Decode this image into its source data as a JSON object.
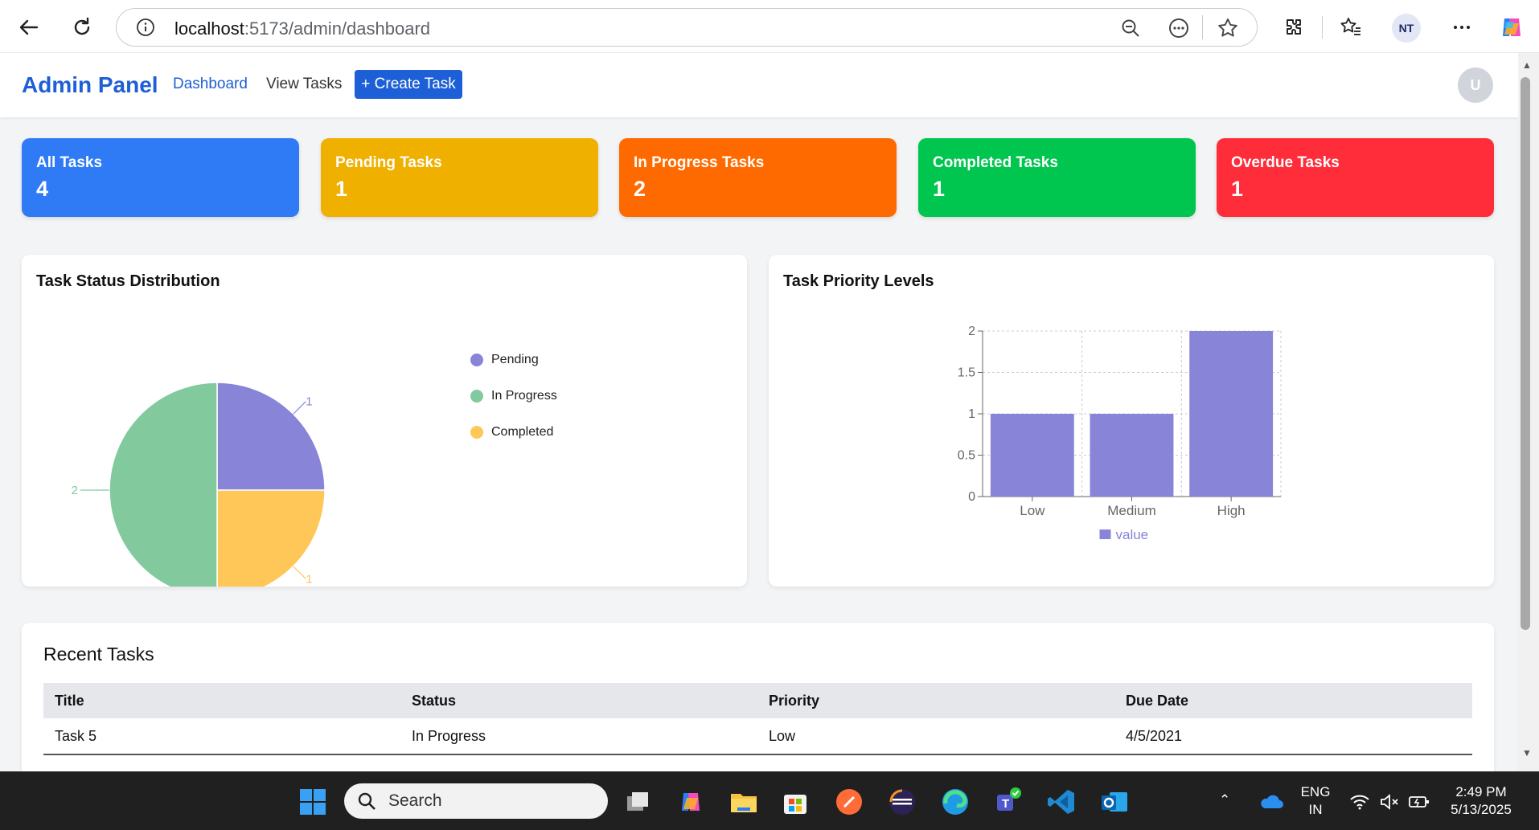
{
  "browser": {
    "url_host": "localhost",
    "url_path": ":5173/admin/dashboard",
    "profile_initials": "NT"
  },
  "app": {
    "brand": "Admin Panel",
    "nav": [
      {
        "label": "Dashboard",
        "active": true
      },
      {
        "label": "View Tasks",
        "active": false
      }
    ],
    "create_button": "+ Create Task",
    "user_initial": "U"
  },
  "stats": [
    {
      "label": "All Tasks",
      "value": "4",
      "color": "#2f7bf5"
    },
    {
      "label": "Pending Tasks",
      "value": "1",
      "color": "#f0b000"
    },
    {
      "label": "In Progress Tasks",
      "value": "2",
      "color": "#ff6a00"
    },
    {
      "label": "Completed Tasks",
      "value": "1",
      "color": "#00c54f"
    },
    {
      "label": "Overdue Tasks",
      "value": "1",
      "color": "#ff2d3a"
    }
  ],
  "status_chart": {
    "title": "Task Status Distribution",
    "legend": [
      {
        "label": "Pending",
        "color": "#8884d8"
      },
      {
        "label": "In Progress",
        "color": "#82ca9d"
      },
      {
        "label": "Completed",
        "color": "#ffc658"
      }
    ]
  },
  "priority_chart": {
    "title": "Task Priority Levels"
  },
  "chart_data": [
    {
      "type": "pie",
      "title": "Task Status Distribution",
      "slices": [
        {
          "label": "Pending",
          "value": 1,
          "color": "#8884d8"
        },
        {
          "label": "Completed",
          "value": 1,
          "color": "#ffc658"
        },
        {
          "label": "In Progress",
          "value": 2,
          "color": "#82ca9d"
        }
      ],
      "legend": "right"
    },
    {
      "type": "bar",
      "title": "Task Priority Levels",
      "categories": [
        "Low",
        "Medium",
        "High"
      ],
      "series": [
        {
          "name": "value",
          "values": [
            1,
            1,
            2
          ],
          "color": "#8884d8"
        }
      ],
      "ylim": [
        0,
        2
      ],
      "yticks": [
        "0",
        "0.5",
        "1",
        "1.5",
        "2"
      ],
      "grid": true,
      "legend": "bottom"
    }
  ],
  "recent_tasks": {
    "title": "Recent Tasks",
    "columns": [
      "Title",
      "Status",
      "Priority",
      "Due Date"
    ],
    "rows": [
      {
        "title": "Task 5",
        "status": "In Progress",
        "priority": "Low",
        "due": "4/5/2021"
      }
    ]
  },
  "taskbar": {
    "search_placeholder": "Search",
    "lang_top": "ENG",
    "lang_bottom": "IN",
    "time": "2:49 PM",
    "date": "5/13/2025"
  }
}
